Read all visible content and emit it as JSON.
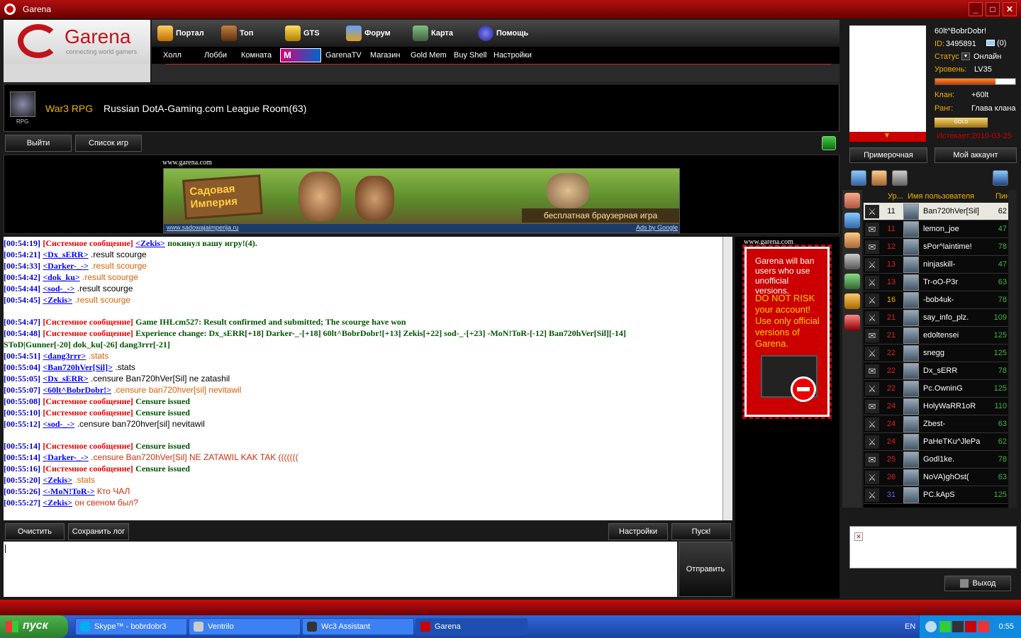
{
  "window": {
    "title": "Garena",
    "buttons": [
      "_",
      "□",
      "✕"
    ]
  },
  "logo": {
    "name": "Garena",
    "tagline": "connecting world gamers"
  },
  "nav_top": [
    {
      "label": "Портал",
      "icon": "home-icon"
    },
    {
      "label": "Топ",
      "icon": "ladder-icon"
    },
    {
      "label": "GTS",
      "icon": "trophy-icon"
    },
    {
      "label": "Форум",
      "icon": "forum-people-icon"
    },
    {
      "label": "Карта",
      "icon": "map-icon"
    },
    {
      "label": "Помощь",
      "icon": "help-icon"
    }
  ],
  "nav_sub": [
    "Холл",
    "Лобби",
    "Комната",
    "GarenaTV",
    "Магазин",
    "Gold Mem",
    "Buy Shell",
    "Настройки"
  ],
  "room": {
    "type": "War3 RPG",
    "name": "Russian DotA-Gaming.com League Room(63)",
    "icon_caption": "RPG"
  },
  "room_buttons": {
    "exit": "Выйти",
    "game_list": "Список игр"
  },
  "ad": {
    "label": "www.garena.com",
    "sign": "Садовая Империя",
    "slogan": "бесплатная браузерная игра",
    "url": "www.sadowajaimperija.ru",
    "ads_by": "Ads by Google"
  },
  "chat_lines": [
    {
      "ts": "[00:54:19]",
      "sys": true,
      "sys_label": "[Системное сообщение]",
      "nick": "<Zekis>",
      "text": "покинул вашу игру!(4).",
      "style": "sys"
    },
    {
      "ts": "[00:54:21]",
      "nick": "<Dx_sERR>",
      "text": ".result scourge",
      "style": "user"
    },
    {
      "ts": "[00:54:33]",
      "nick": "<Darker-_->",
      "text": ".result scourge",
      "style": "orange"
    },
    {
      "ts": "[00:54:42]",
      "nick": "<dok_ku>",
      "text": ".result scourge",
      "style": "orange"
    },
    {
      "ts": "[00:54:44]",
      "nick": "<sod-_->",
      "text": ".result scourge",
      "style": "user"
    },
    {
      "ts": "[00:54:45]",
      "nick": "<Zekis>",
      "text": ".result scourge",
      "style": "orange"
    },
    {
      "blank": true
    },
    {
      "ts": "[00:54:47]",
      "sys": true,
      "sys_label": "[Системное сообщение]",
      "text": "Game IHLcm527: Result confirmed and submitted; The scourge have won",
      "style": "sys"
    },
    {
      "ts": "[00:54:48]",
      "sys": true,
      "sys_label": "[Системное сообщение]",
      "text": "Experience change: Dx_sERR[+18] Darker-_-[+18] 60lt^BobrDobr![+13] Zekis[+22] sod-_-[+23] -MoN!ToR-[-12] Ban720hVer[Sil][-14]",
      "style": "sys"
    },
    {
      "cont": "SToD|Gunner[-20] dok_ku[-26] dang3rrr[-21]",
      "style": "sys"
    },
    {
      "ts": "[00:54:51]",
      "nick": "<dang3rrr>",
      "text": ".stats",
      "style": "orange"
    },
    {
      "ts": "[00:55:04]",
      "nick": "<Ban720hVer[Sil]>",
      "text": ".stats",
      "style": "user"
    },
    {
      "ts": "[00:55:05]",
      "nick": "<Dx_sERR>",
      "text": ".censure Ban720hVer[Sil] ne zatashil",
      "style": "user"
    },
    {
      "ts": "[00:55:07]",
      "nick": "<60lt^BobrDobr!>",
      "text": ".censure ban720hver[sil] nevitawil",
      "style": "orange"
    },
    {
      "ts": "[00:55:08]",
      "sys": true,
      "sys_label": "[Системное сообщение]",
      "text": "Censure issued",
      "style": "sys"
    },
    {
      "ts": "[00:55:10]",
      "sys": true,
      "sys_label": "[Системное сообщение]",
      "text": "Censure issued",
      "style": "sys"
    },
    {
      "ts": "[00:55:12]",
      "nick": "<sod-_->",
      "text": ".censure ban720hver[sil] nevitawil",
      "style": "user"
    },
    {
      "blank": true
    },
    {
      "ts": "[00:55:14]",
      "sys": true,
      "sys_label": "[Системное сообщение]",
      "text": "Censure issued",
      "style": "sys"
    },
    {
      "ts": "[00:55:14]",
      "nick": "<Darker-_->",
      "text": ".censure Ban720hVer[Sil] NE ZATAWIL KAK TAK (((((((",
      "style": "red"
    },
    {
      "ts": "[00:55:16]",
      "sys": true,
      "sys_label": "[Системное сообщение]",
      "text": "Censure issued",
      "style": "sys"
    },
    {
      "ts": "[00:55:20]",
      "nick": "<Zekis>",
      "text": ".stats",
      "style": "orange"
    },
    {
      "ts": "[00:55:26]",
      "nick": "<-MoN!ToR->",
      "text": "Кто ЧАЛ",
      "style": "red"
    },
    {
      "ts": "[00:55:27]",
      "nick": "<Zekis>",
      "text": "он свеном был?",
      "style": "red"
    }
  ],
  "chat_buttons": {
    "clear": "Очистить",
    "save_log": "Сохранить лог",
    "settings": "Настройки",
    "start": "Пуск!",
    "send": "Отправить"
  },
  "side_ad": {
    "label": "www.garena.com",
    "line1": "Garena will ban users who use unofficial versions.",
    "line2": "DO NOT RISK your account! Use only official versions of Garena."
  },
  "profile": {
    "name": "60lt^BobrDobr!",
    "id_label": "ID:",
    "id": "3495891",
    "mail_count": "(0)",
    "status_label": "Статус",
    "status": "Онлайн",
    "level_label": "Уровень:",
    "level": "LV35",
    "xp_fraction": 0.75,
    "clan_label": "Клан:",
    "clan": "+60lt",
    "rank_label": "Ранг:",
    "rank": "Глава клана",
    "badge": "GOLD",
    "expire": "Истекает:2010-03-25",
    "fitting_room": "Примерочная",
    "my_account": "Мой аккаунт"
  },
  "users_header": {
    "level": "Ур...",
    "name": "Имя пользователя",
    "ping": "Пин"
  },
  "users": [
    {
      "lv": "11",
      "name": "Ban720hVer[Sil]",
      "ping": "62",
      "state": "sword",
      "lvcolor": "#000",
      "selected": true
    },
    {
      "lv": "11",
      "name": "lemon_joe",
      "ping": "47",
      "state": "chat",
      "lvcolor": "#e02020"
    },
    {
      "lv": "12",
      "name": "sPor^laintime!",
      "ping": "78",
      "state": "chat",
      "lvcolor": "#e02020"
    },
    {
      "lv": "13",
      "name": "ninjaskill-",
      "ping": "47",
      "state": "sword",
      "lvcolor": "#e02020"
    },
    {
      "lv": "13",
      "name": "Tr-oO-P3r",
      "ping": "63",
      "state": "sword",
      "lvcolor": "#e02020"
    },
    {
      "lv": "16",
      "name": "-bob4uk-",
      "ping": "78",
      "state": "sword",
      "lvcolor": "#f0b000"
    },
    {
      "lv": "21",
      "name": "say_info_plz.",
      "ping": "109",
      "state": "sword",
      "lvcolor": "#e02020"
    },
    {
      "lv": "21",
      "name": "edoltensei",
      "ping": "125",
      "state": "chat",
      "lvcolor": "#e02020"
    },
    {
      "lv": "22",
      "name": "snegg",
      "ping": "125",
      "state": "sword",
      "lvcolor": "#e02020"
    },
    {
      "lv": "22",
      "name": "Dx_sERR",
      "ping": "78",
      "state": "chat",
      "lvcolor": "#e02020"
    },
    {
      "lv": "22",
      "name": "Pc.OwninG",
      "ping": "125",
      "state": "sword",
      "lvcolor": "#e02020"
    },
    {
      "lv": "24",
      "name": "HolyWaRR1oR",
      "ping": "110",
      "state": "chat",
      "lvcolor": "#e02020"
    },
    {
      "lv": "24",
      "name": "Zbest-",
      "ping": "63",
      "state": "sword",
      "lvcolor": "#e02020"
    },
    {
      "lv": "24",
      "name": "PaHeTKu^JlePa",
      "ping": "62",
      "state": "sword",
      "lvcolor": "#e02020"
    },
    {
      "lv": "25",
      "name": "Godl1ke.",
      "ping": "78",
      "state": "chat",
      "lvcolor": "#e02020"
    },
    {
      "lv": "26",
      "name": "NoVA)ghOst(",
      "ping": "63",
      "state": "sword",
      "lvcolor": "#e02020"
    },
    {
      "lv": "31",
      "name": "PC.kApS",
      "ping": "125",
      "state": "sword",
      "lvcolor": "#6060ff"
    }
  ],
  "exit_button": "Выход",
  "taskbar": {
    "start": "пуск",
    "tasks": [
      {
        "label": "Skype™ - bobrdobr3",
        "color": "#00aff0"
      },
      {
        "label": "Ventrilo",
        "color": "#888"
      },
      {
        "label": "Wc3 Assistant",
        "color": "#333"
      },
      {
        "label": "Garena",
        "color": "#c00"
      }
    ],
    "lang": "EN",
    "clock": "0:55"
  }
}
